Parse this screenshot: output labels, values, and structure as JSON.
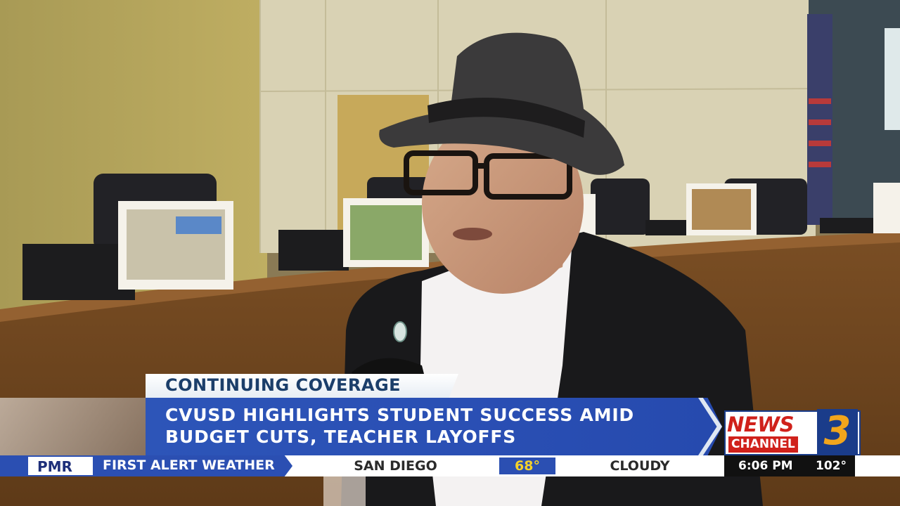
{
  "lower_third": {
    "kicker": "CONTINUING COVERAGE",
    "headline_line1": "CVUSD HIGHLIGHTS STUDENT SUCCESS AMID",
    "headline_line2": "BUDGET CUTS, TEACHER LAYOFFS"
  },
  "station_logo": {
    "news": "NEWS",
    "channel": "CHANNEL",
    "number": "3"
  },
  "ticker": {
    "sponsor": "PMR",
    "segment": "FIRST ALERT WEATHER",
    "city": "SAN DIEGO",
    "temperature": "68°",
    "condition": "CLOUDY",
    "time": "6:06 PM",
    "secondary_temperature": "102°"
  },
  "colors": {
    "brand_blue": "#2b4fb2",
    "brand_red": "#d0211b",
    "logo_gold": "#f2a51c",
    "temp_yellow": "#f5d22a"
  }
}
